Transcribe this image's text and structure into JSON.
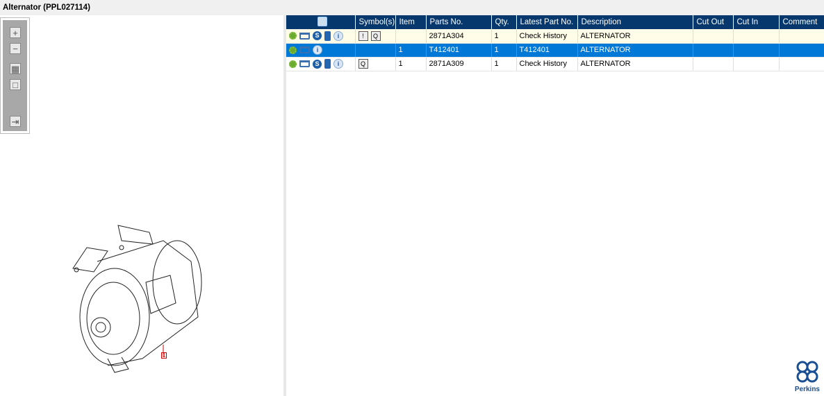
{
  "title": "Alternator (PPL027114)",
  "toolbar": {
    "zoom_in": "+",
    "zoom_out": "−",
    "fit": "▦",
    "actual": "□",
    "export": "⇥"
  },
  "table": {
    "headers": [
      "",
      "Symbol(s)",
      "Item",
      "Parts No.",
      "Qty.",
      "Latest Part No.",
      "Description",
      "Cut Out",
      "Cut In",
      "Comment"
    ],
    "rows": [
      {
        "icons": [
          "gear",
          "cart",
          "s",
          "book",
          "info"
        ],
        "symbols": [
          "!",
          "book-search"
        ],
        "item": "",
        "parts_no": "2871A304",
        "qty": "1",
        "latest": "Check History",
        "description": "ALTERNATOR",
        "cut_out": "",
        "cut_in": "",
        "comment": ""
      },
      {
        "icons": [
          "gear",
          "cart",
          "info"
        ],
        "symbols": [],
        "item": "1",
        "parts_no": "T412401",
        "qty": "1",
        "latest": "T412401",
        "description": "ALTERNATOR",
        "cut_out": "",
        "cut_in": "",
        "comment": "",
        "selected": true
      },
      {
        "icons": [
          "gear",
          "cart",
          "s",
          "book",
          "info"
        ],
        "symbols": [
          "book-search"
        ],
        "item": "1",
        "parts_no": "2871A309",
        "qty": "1",
        "latest": "Check History",
        "description": "ALTERNATOR",
        "cut_out": "",
        "cut_in": "",
        "comment": ""
      }
    ]
  },
  "diagram": {
    "callout": "1"
  },
  "logo": {
    "text": "Perkins"
  },
  "colors": {
    "header": "#06386e",
    "selected": "#0078d7",
    "row_highlight": "#fffde8"
  }
}
